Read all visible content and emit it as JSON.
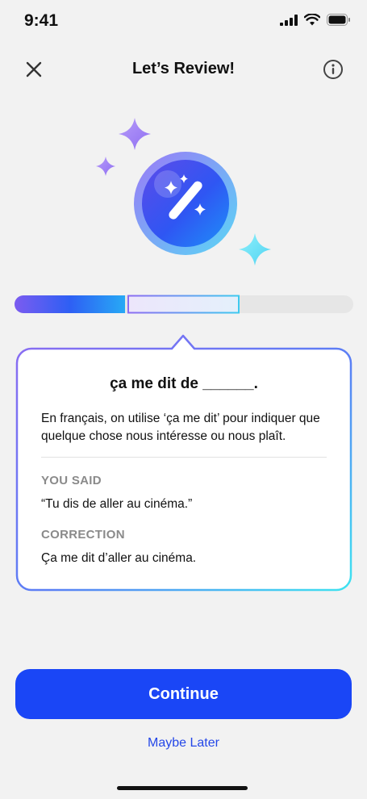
{
  "status_bar": {
    "time": "9:41",
    "icons": [
      "signal-icon",
      "wifi-icon",
      "battery-icon"
    ]
  },
  "header": {
    "title": "Let’s Review!",
    "close_icon": "close-icon",
    "info_icon": "info-icon"
  },
  "hero": {
    "icon": "magic-wand-icon",
    "sparkles": [
      "sparkle-icon",
      "sparkle-icon",
      "sparkle-icon"
    ]
  },
  "progress": {
    "segments_total": 3,
    "completed": 1,
    "current": 2
  },
  "card": {
    "question": "ça me dit de ______.",
    "explanation": "En français, on utilise ‘ça me dit’ pour indiquer que quelque chose nous intéresse ou nous plaît.",
    "you_said_label": "YOU SAID",
    "you_said_text": "“Tu dis de aller au cinéma.”",
    "correction_label": "CORRECTION",
    "correction_text": "Ça me dit d’aller au cinéma."
  },
  "actions": {
    "continue_label": "Continue",
    "maybe_later_label": "Maybe Later"
  },
  "colors": {
    "primary": "#1a46f6",
    "link": "#2447e8",
    "gradient_start": "#7b5cf0",
    "gradient_end": "#3ee0f0"
  }
}
